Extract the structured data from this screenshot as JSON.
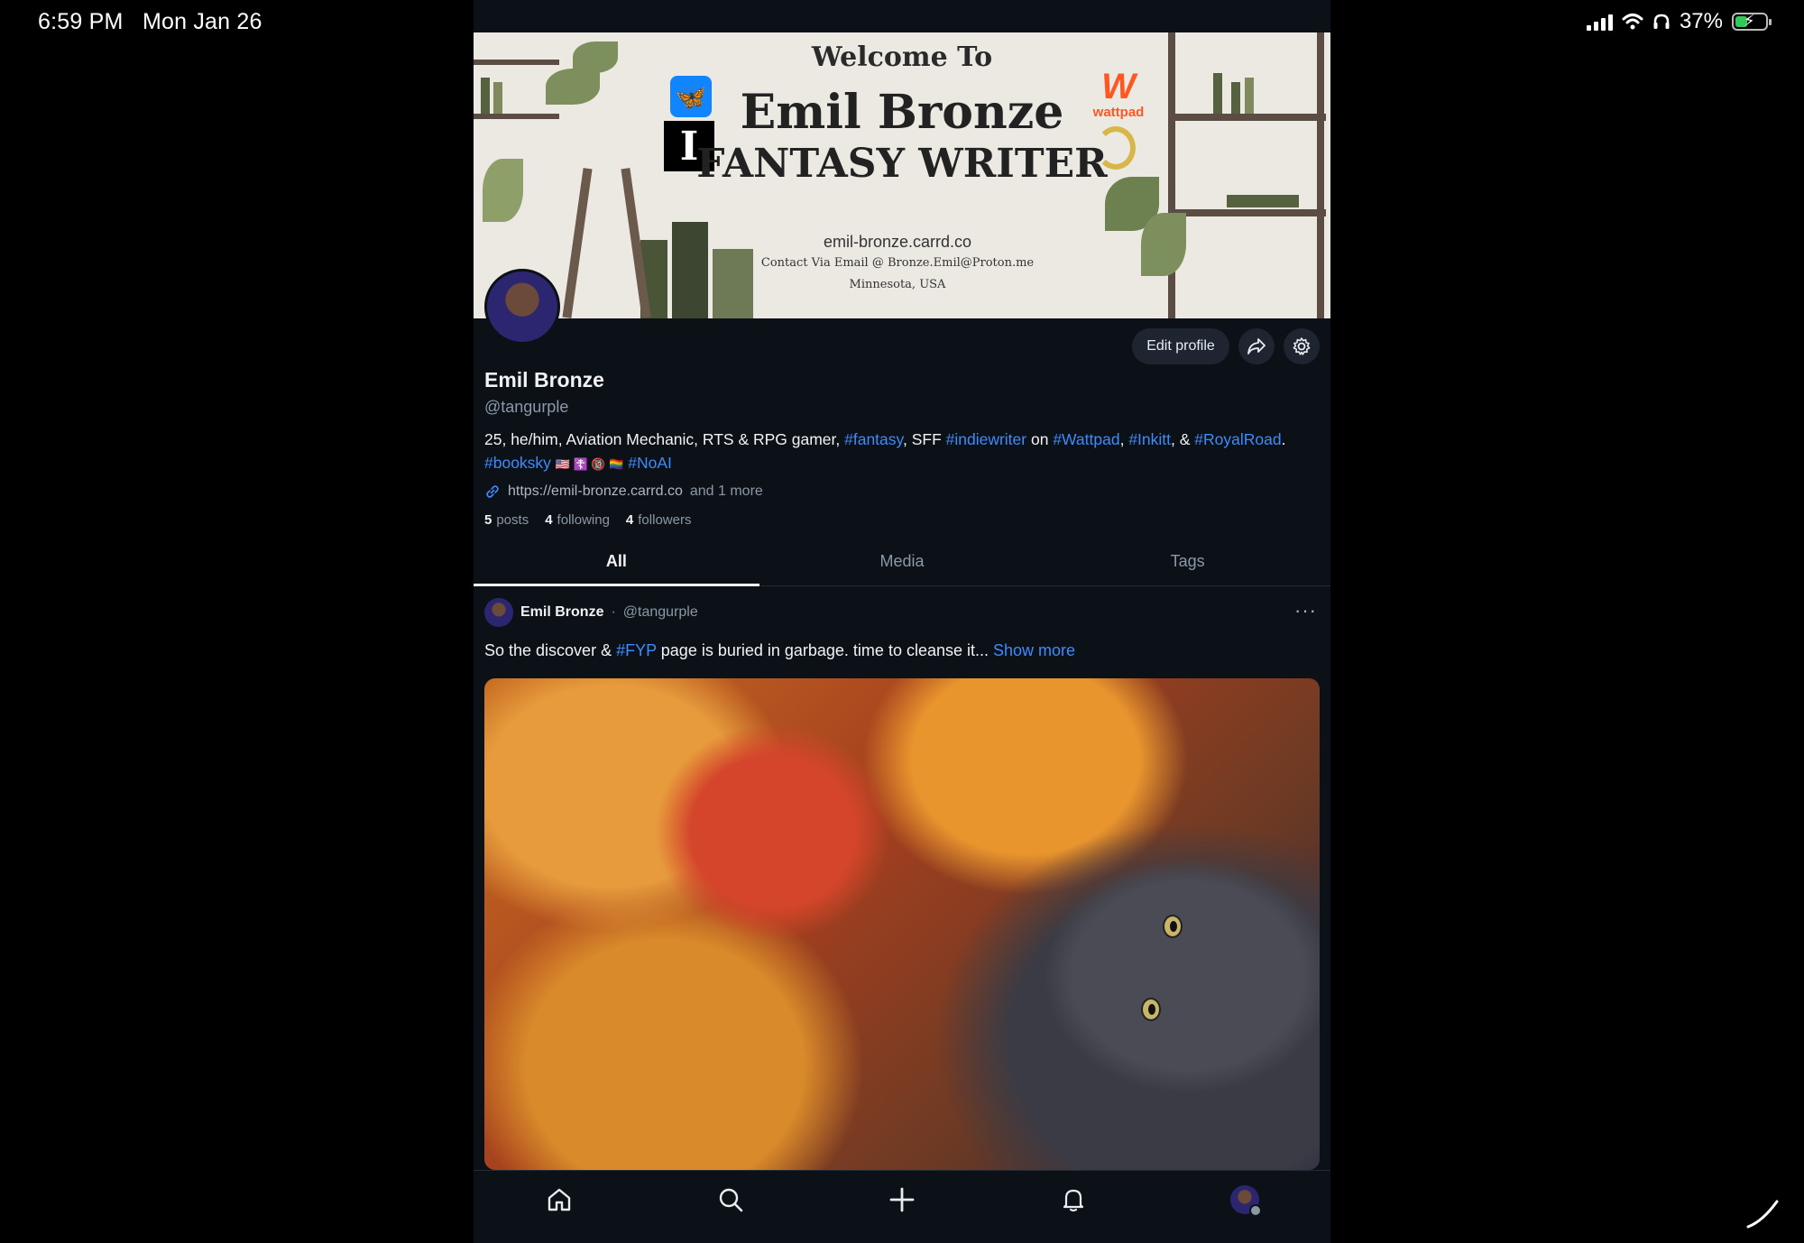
{
  "status_bar": {
    "time": "6:59 PM",
    "date": "Mon Jan 26",
    "battery": "37%",
    "icons": [
      "signal-icon",
      "wifi-icon",
      "headphones-icon",
      "battery-charging-icon"
    ]
  },
  "banner": {
    "welcome": "Welcome To",
    "name": "Emil Bronze",
    "title": "FANTASY WRITER",
    "site": "emil-bronze.carrd.co",
    "contact": "Contact Via Email @ Bronze.Emil@Proton.me",
    "location": "Minnesota, USA",
    "wattpad_label": "wattpad"
  },
  "profile": {
    "edit_label": "Edit profile",
    "name": "Emil Bronze",
    "handle": "@tangurple",
    "bio_parts": {
      "p1": "25, he/him, Aviation Mechanic, RTS & RPG gamer, ",
      "t1": "#fantasy",
      "p2": ", SFF ",
      "t2": "#indiewriter",
      "p3": " on ",
      "t3": "#Wattpad",
      "p4": ", ",
      "t4": "#Inkitt",
      "p5": ", & ",
      "t5": "#RoyalRoad",
      "p6": ".",
      "t6": "#booksky",
      "emojis": "🇺🇸 ☦️ 🔞 🏳️‍🌈",
      "t7": "#NoAI"
    },
    "link": "https://emil-bronze.carrd.co",
    "link_more": "and 1 more",
    "stats": {
      "posts_count": "5",
      "posts_label": "posts",
      "following_count": "4",
      "following_label": "following",
      "followers_count": "4",
      "followers_label": "followers"
    }
  },
  "tabs": [
    {
      "label": "All",
      "active": true
    },
    {
      "label": "Media",
      "active": false
    },
    {
      "label": "Tags",
      "active": false
    }
  ],
  "post": {
    "author": "Emil Bronze",
    "separator": "·",
    "handle": "@tangurple",
    "more": "···",
    "text_before": "So the discover & ",
    "tag": "#FYP",
    "text_after": " page is buried in garbage. time to cleanse it... ",
    "show_more": "Show more"
  },
  "bottom_nav": [
    "home-icon",
    "search-icon",
    "plus-icon",
    "bell-icon",
    "profile-avatar"
  ],
  "colors": {
    "background": "#0c1117",
    "link": "#3d8bfd",
    "muted": "#8b98a5"
  }
}
